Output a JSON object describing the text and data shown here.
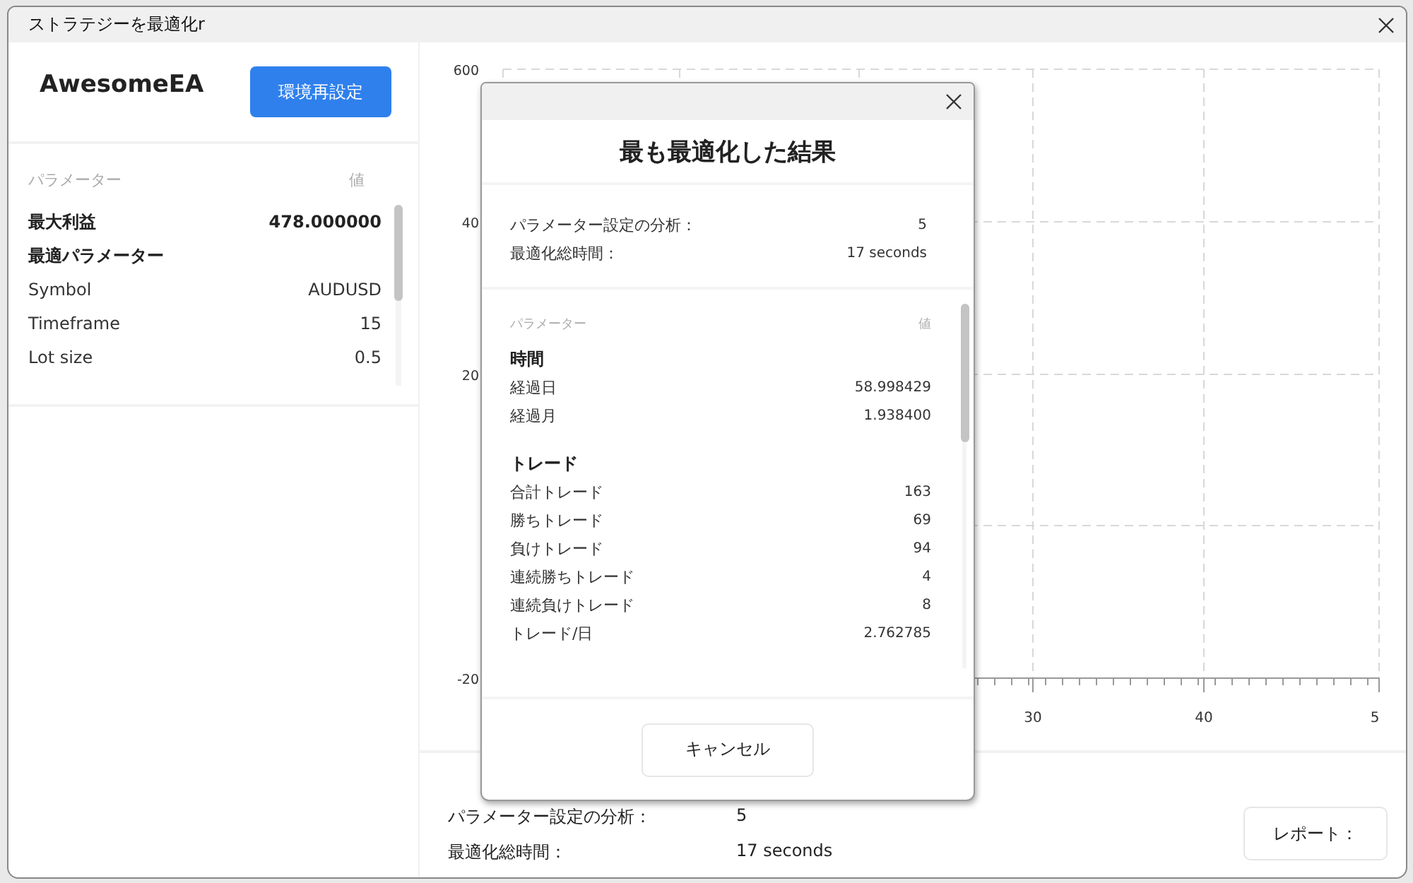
{
  "window": {
    "title": "ストラテジーを最適化r"
  },
  "strategy": {
    "name": "AwesomeEA",
    "reset_button": "環境再設定"
  },
  "params": {
    "header": {
      "name": "パラメーター",
      "value": "値"
    },
    "rows": [
      {
        "kind": "bold",
        "label": "最大利益",
        "value": "478.000000"
      },
      {
        "kind": "heading",
        "label": "最適パラメーター"
      },
      {
        "kind": "plain",
        "label": "Symbol",
        "value": "AUDUSD"
      },
      {
        "kind": "plain",
        "label": "Timeframe",
        "value": "15"
      },
      {
        "kind": "plain",
        "label": "Lot size",
        "value": "0.5"
      }
    ]
  },
  "chart": {
    "y_tick_labels": [
      "600",
      "40",
      "20",
      "-20"
    ],
    "x_tick_labels": [
      "30",
      "40",
      "5"
    ]
  },
  "summary": [
    {
      "label": "パラメーター設定の分析：",
      "value": "5"
    },
    {
      "label": "最適化総時間：",
      "value": "17 seconds"
    }
  ],
  "report_button": "レポート：",
  "dialog": {
    "title": "最も最適化した結果",
    "summary": [
      {
        "label": "パラメーター設定の分析：",
        "value": "5"
      },
      {
        "label": "最適化総時間：",
        "value": "17 seconds"
      }
    ],
    "header": {
      "name": "パラメーター",
      "value": "値"
    },
    "sections": [
      {
        "title": "時間",
        "rows": [
          {
            "label": "経過日",
            "value": "58.998429"
          },
          {
            "label": "経過月",
            "value": "1.938400"
          }
        ]
      },
      {
        "title": "トレード",
        "rows": [
          {
            "label": "合計トレード",
            "value": "163"
          },
          {
            "label": "勝ちトレード",
            "value": "69"
          },
          {
            "label": "負けトレード",
            "value": "94"
          },
          {
            "label": "連続勝ちトレード",
            "value": "4"
          },
          {
            "label": "連続負けトレード",
            "value": "8"
          },
          {
            "label": "トレード/日",
            "value": "2.762785"
          }
        ]
      }
    ],
    "cancel_button": "キャンセル"
  }
}
